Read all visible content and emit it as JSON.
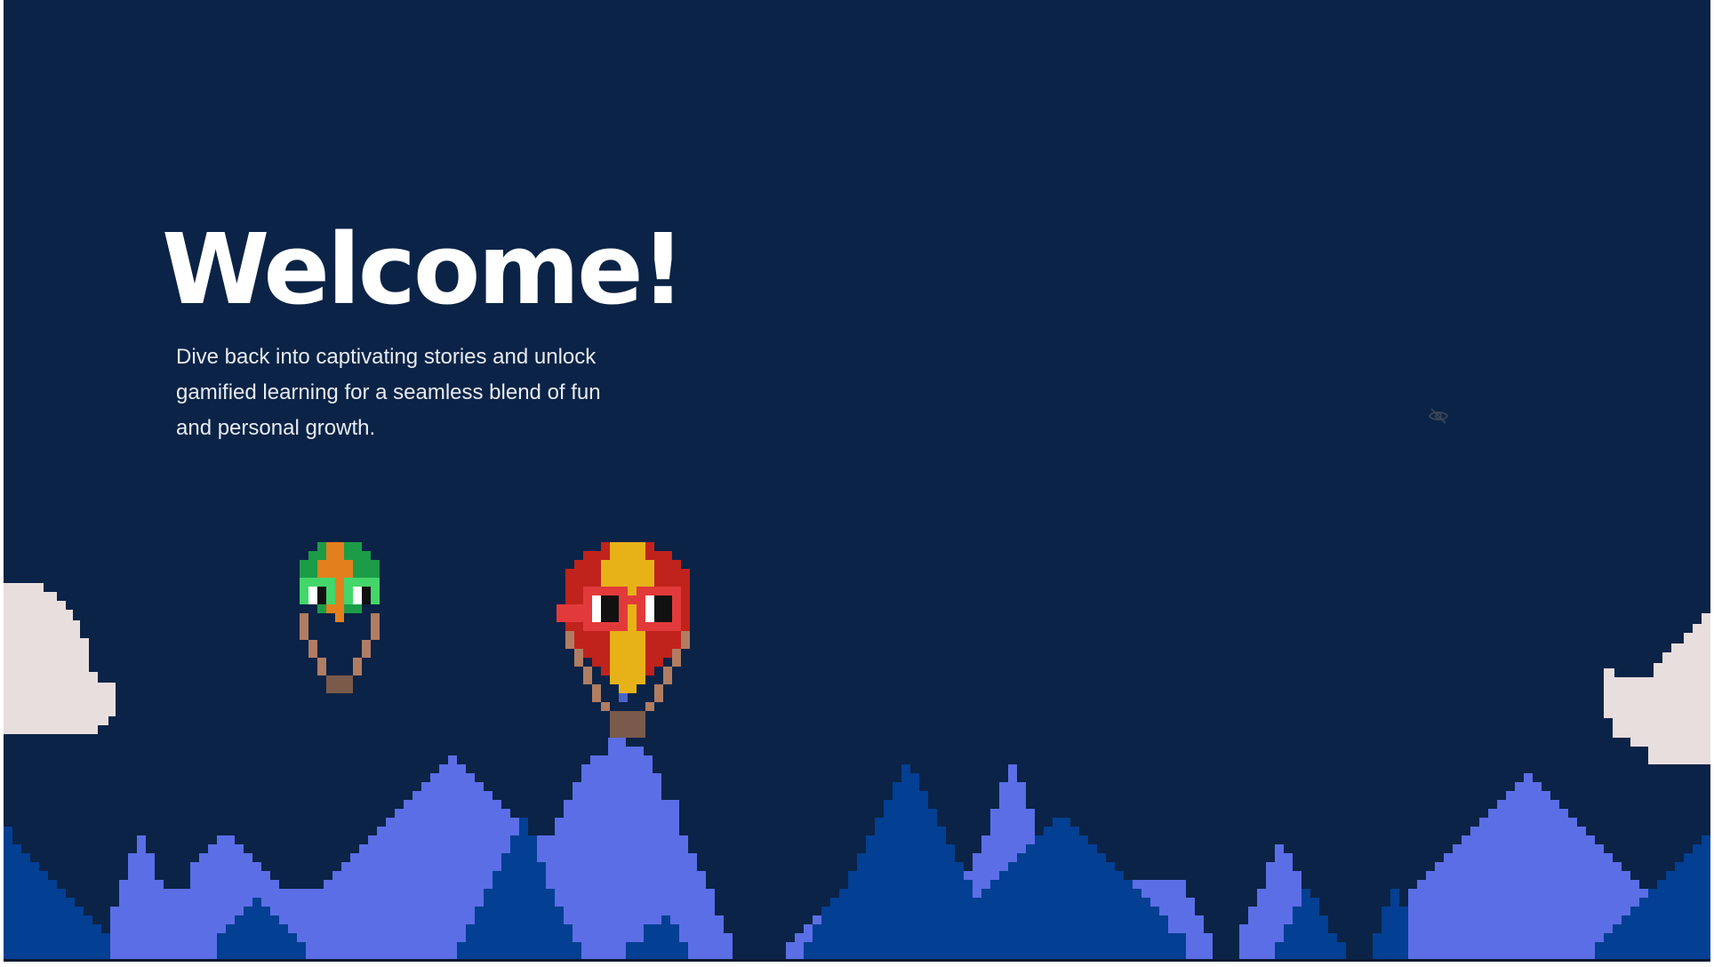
{
  "hero": {
    "title": "Welcome!",
    "subtitle": "Dive back into captivating stories and unlock gamified learning for a seamless blend of fun and personal growth."
  },
  "icons": {
    "visibility": "eye-off-icon"
  },
  "colors": {
    "sky": "#0b2346",
    "mountain_light": "#5b6ee6",
    "mountain_dark": "#033f92",
    "cloud": "#e8dede",
    "balloon_red": "#c0231b",
    "balloon_yellow": "#e7b217",
    "balloon_green": "#1c9c47",
    "balloon_orange": "#e2801e"
  }
}
